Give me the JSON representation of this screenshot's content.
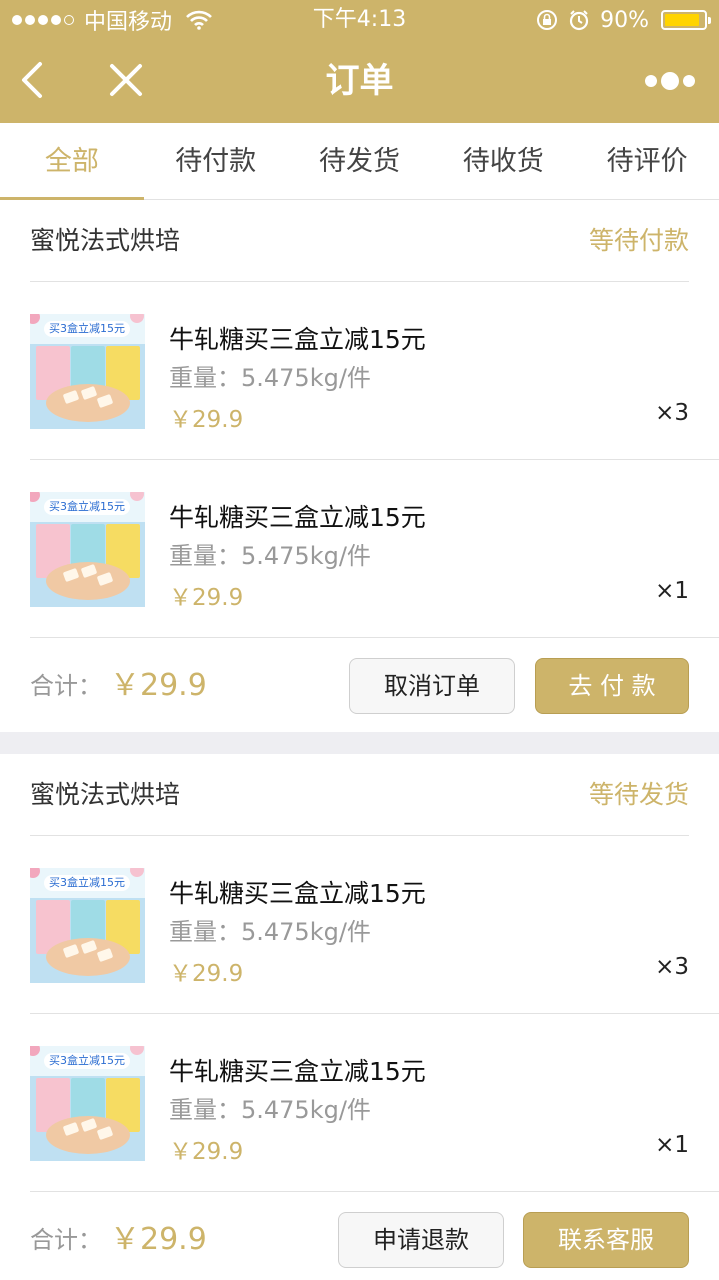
{
  "status_bar": {
    "carrier": "中国移动",
    "time": "下午4:13",
    "battery_percent": "90%",
    "battery_level": 0.9
  },
  "nav": {
    "title": "订单",
    "back_icon": "chevron-left-icon",
    "close_icon": "close-icon",
    "more_icon": "more-dots-icon"
  },
  "tabs": [
    {
      "label": "全部",
      "active": true
    },
    {
      "label": "待付款",
      "active": false
    },
    {
      "label": "待发货",
      "active": false
    },
    {
      "label": "待收货",
      "active": false
    },
    {
      "label": "待评价",
      "active": false
    }
  ],
  "orders": [
    {
      "shop": "蜜悦法式烘培",
      "status": "等待付款",
      "items": [
        {
          "title": "牛轧糖买三盒立减15元",
          "weight": "重量：5.475kg/件",
          "price": "￥29.9",
          "qty": "×3",
          "image_banner": "买3盒立减15元"
        },
        {
          "title": "牛轧糖买三盒立减15元",
          "weight": "重量：5.475kg/件",
          "price": "￥29.9",
          "qty": "×1",
          "image_banner": "买3盒立减15元"
        }
      ],
      "total_label": "合计：",
      "total": "￥29.9",
      "buttons": {
        "secondary": "取消订单",
        "primary": "去 付 款"
      }
    },
    {
      "shop": "蜜悦法式烘培",
      "status": "等待发货",
      "items": [
        {
          "title": "牛轧糖买三盒立减15元",
          "weight": "重量：5.475kg/件",
          "price": "￥29.9",
          "qty": "×3",
          "image_banner": "买3盒立减15元"
        },
        {
          "title": "牛轧糖买三盒立减15元",
          "weight": "重量：5.475kg/件",
          "price": "￥29.9",
          "qty": "×1",
          "image_banner": "买3盒立减15元"
        }
      ],
      "total_label": "合计：",
      "total": "￥29.9",
      "buttons": {
        "secondary": "申请退款",
        "primary": "联系客服"
      }
    }
  ],
  "colors": {
    "accent": "#cdb46a",
    "background": "#eeeef2",
    "battery": "#ffd400"
  }
}
